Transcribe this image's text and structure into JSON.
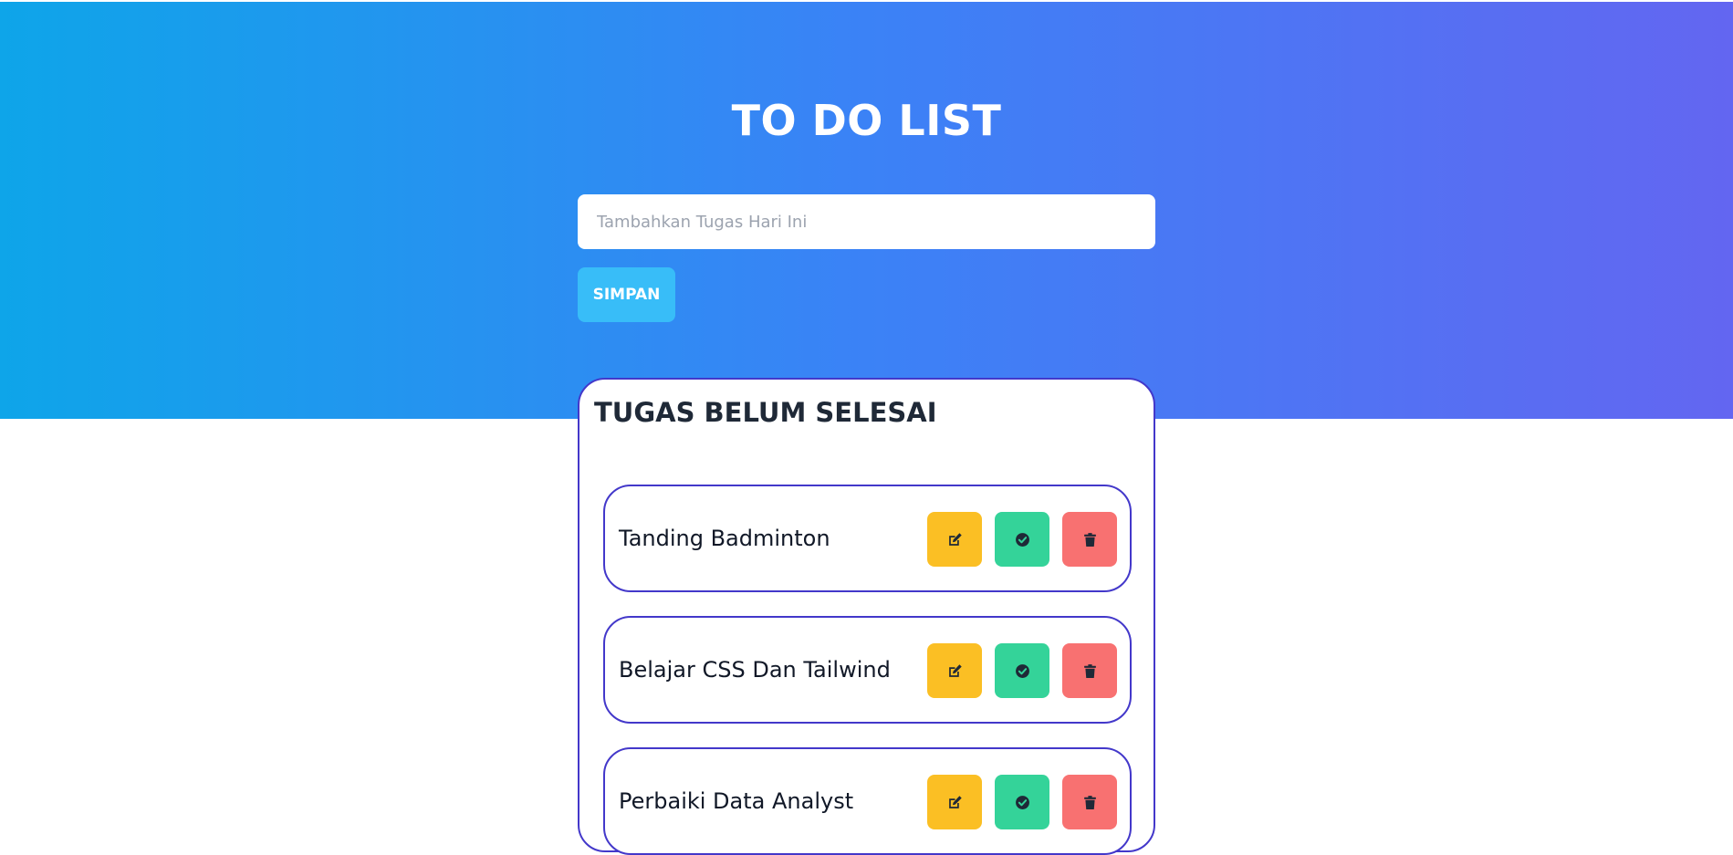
{
  "header": {
    "title": "TO DO LIST"
  },
  "form": {
    "input_placeholder": "Tambahkan Tugas Hari Ini",
    "input_value": "",
    "save_label": "SIMPAN"
  },
  "pending": {
    "title": "TUGAS BELUM SELESAI",
    "tasks": [
      {
        "label": "Tanding Badminton"
      },
      {
        "label": "Belajar CSS Dan Tailwind"
      },
      {
        "label": "Perbaiki Data Analyst"
      }
    ]
  },
  "icons": {
    "edit": "edit-icon",
    "done": "check-circle-icon",
    "delete": "trash-icon"
  },
  "colors": {
    "gradient_start": "#0ea5e9",
    "gradient_end": "#6366f1",
    "save_button": "#38bdf8",
    "edit_button": "#fbbf24",
    "done_button": "#34d399",
    "delete_button": "#f87171",
    "card_border": "#4338ca"
  }
}
